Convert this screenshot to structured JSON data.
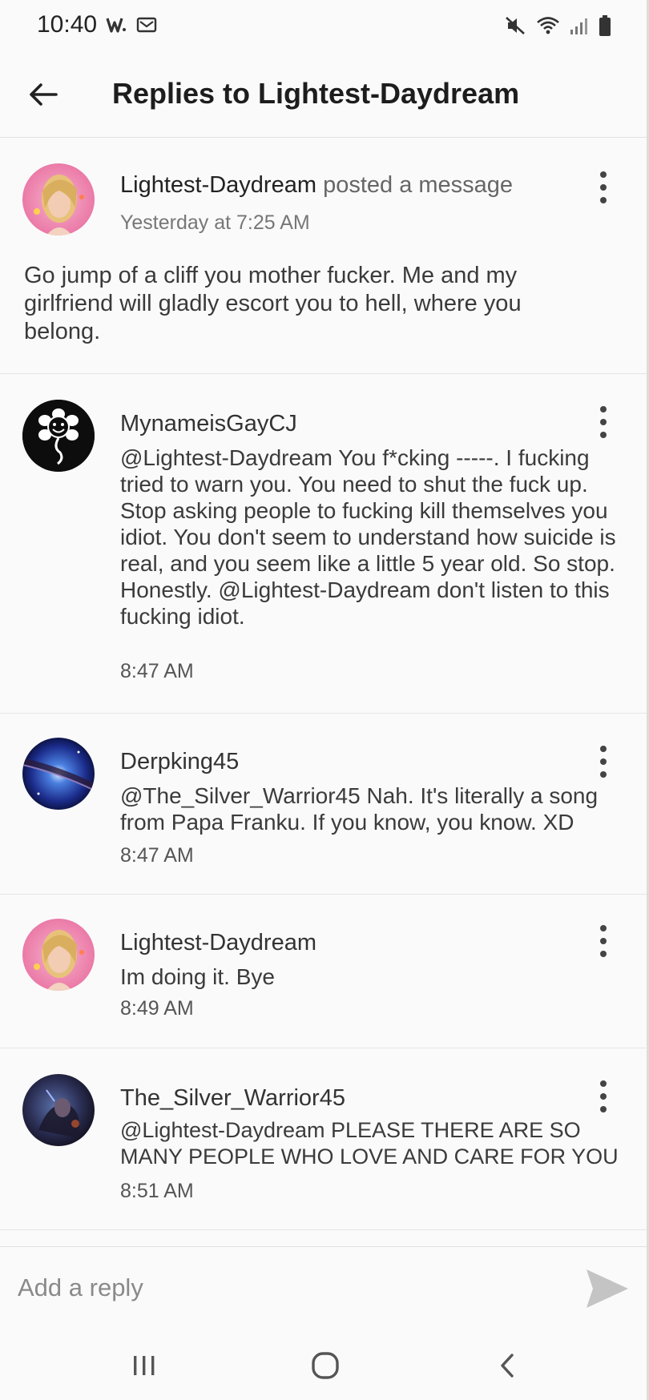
{
  "status_bar": {
    "time": "10:40",
    "left_icons": [
      "w-app-icon",
      "mail-icon"
    ],
    "right_icons": [
      "muted-icon",
      "wifi-icon",
      "signal-icon",
      "battery-icon"
    ]
  },
  "header": {
    "title": "Replies to Lightest-Daydream",
    "back_icon": "arrow-left-icon"
  },
  "original_post": {
    "author": "Lightest-Daydream",
    "action": "posted a message",
    "time": "Yesterday at 7:25 AM",
    "body": "Go jump of a cliff you mother fucker. Me and my girlfriend will gladly escort you to hell, where you belong."
  },
  "replies": [
    {
      "author": "MynameisGayCJ",
      "body": "@Lightest-Daydream You f*cking -----. I fucking tried to warn you. You need to shut the fuck up. Stop asking people to fucking kill themselves you idiot. You don't seem to understand how suicide is real, and you seem like a little 5 year old. So stop.\nHonestly. @Lightest-Daydream don't listen to this fucking idiot.",
      "time": "8:47 AM"
    },
    {
      "author": "Derpking45",
      "body": "@The_Silver_Warrior45 Nah. It's literally a song from Papa Franku. If you know, you know. XD",
      "time": "8:47 AM"
    },
    {
      "author": "Lightest-Daydream",
      "body": "Im doing it. Bye",
      "time": "8:49 AM"
    },
    {
      "author": "The_Silver_Warrior45",
      "body": "@Lightest-Daydream PLEASE THERE ARE SO MANY PEOPLE WHO LOVE AND CARE FOR YOU",
      "time": "8:51 AM"
    }
  ],
  "composer": {
    "placeholder": "Add a reply",
    "send_icon": "send-icon"
  },
  "nav": {
    "icons": [
      "recent-apps-icon",
      "home-icon",
      "back-icon"
    ]
  },
  "colors": {
    "background": "#fafafa",
    "divider": "#e6e6e6",
    "send_icon": "#c4c4c4",
    "title_text": "#1d1d1d"
  }
}
